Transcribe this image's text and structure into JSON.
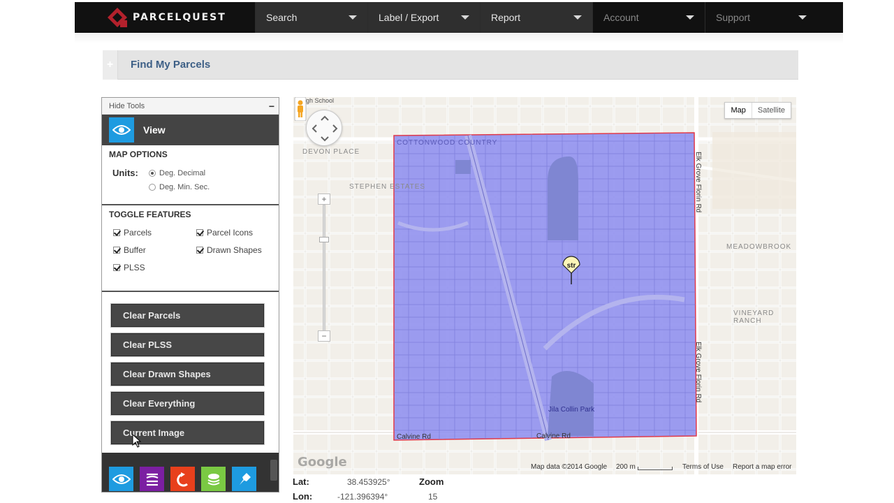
{
  "brand": {
    "name": "PARCELQUEST",
    "color": "#b3212c"
  },
  "nav": {
    "items": [
      {
        "label": "Search"
      },
      {
        "label": "Label / Export"
      },
      {
        "label": "Report"
      },
      {
        "label": "Account"
      },
      {
        "label": "Support"
      }
    ]
  },
  "page": {
    "title": "Find My Parcels"
  },
  "tools": {
    "hide_label": "Hide Tools",
    "view_label": "View",
    "map_options": {
      "heading": "MAP OPTIONS",
      "units_label": "Units:",
      "units_options": [
        {
          "label": "Deg. Decimal",
          "selected": true
        },
        {
          "label": "Deg. Min. Sec.",
          "selected": false
        }
      ]
    },
    "toggle_features": {
      "heading": "TOGGLE FEATURES",
      "items": [
        {
          "label": "Parcels",
          "checked": true
        },
        {
          "label": "Parcel Icons",
          "checked": true
        },
        {
          "label": "Buffer",
          "checked": true
        },
        {
          "label": "Drawn Shapes",
          "checked": true
        },
        {
          "label": "PLSS",
          "checked": true
        }
      ]
    },
    "buttons": [
      {
        "label": "Clear Parcels"
      },
      {
        "label": "Clear PLSS"
      },
      {
        "label": "Clear Drawn Shapes"
      },
      {
        "label": "Clear Everything"
      },
      {
        "label": "Current Image"
      }
    ],
    "footer_icons": [
      {
        "name": "view-eye-icon",
        "color": "#1e9be0"
      },
      {
        "name": "layers-icon",
        "color": "#7b1fa2"
      },
      {
        "name": "return-arrow-icon",
        "color": "#e8401c"
      },
      {
        "name": "stack-icon",
        "color": "#7ac943"
      },
      {
        "name": "pin-edit-icon",
        "color": "#1e9be0"
      }
    ]
  },
  "map": {
    "type_buttons": [
      {
        "label": "Map",
        "active": true
      },
      {
        "label": "Satellite",
        "active": false
      }
    ],
    "marker_label": "str",
    "labels": {
      "high_school": "...High School",
      "devon_place": "DEVON PLACE",
      "cottonwood_country": "COTTONWOOD COUNTRY",
      "stephan_estates": "STEPHEN ESTATES",
      "meadowbrook": "MEADOWBROOK",
      "vineyard_ranch": "VINEYARD RANCH",
      "calvine_rd_left": "Calvine Rd",
      "calvine_rd_right": "Calvine Rd",
      "elk_grove_florin_top": "Elk Grove Florin Rd",
      "elk_grove_florin_bottom": "Elk Grove Florin Rd",
      "park": "Jila Collin Park"
    },
    "attribution": {
      "google": "Google",
      "data": "Map data ©2014 Google",
      "scale": "200 m",
      "terms": "Terms of Use",
      "report": "Report a map error"
    },
    "parcel_fill": "#8c8cf0",
    "parcel_border": "#e0394a"
  },
  "coords": {
    "lat_label": "Lat:",
    "lat_value": "38.453925°",
    "lon_label": "Lon:",
    "lon_value": "-121.396394°",
    "zoom_label": "Zoom",
    "zoom_value": "15"
  },
  "colors": {
    "nav_bg": "#111111",
    "nav_active": "#2f2f2f",
    "title_color": "#3d5f86",
    "button_bg": "#474747"
  }
}
